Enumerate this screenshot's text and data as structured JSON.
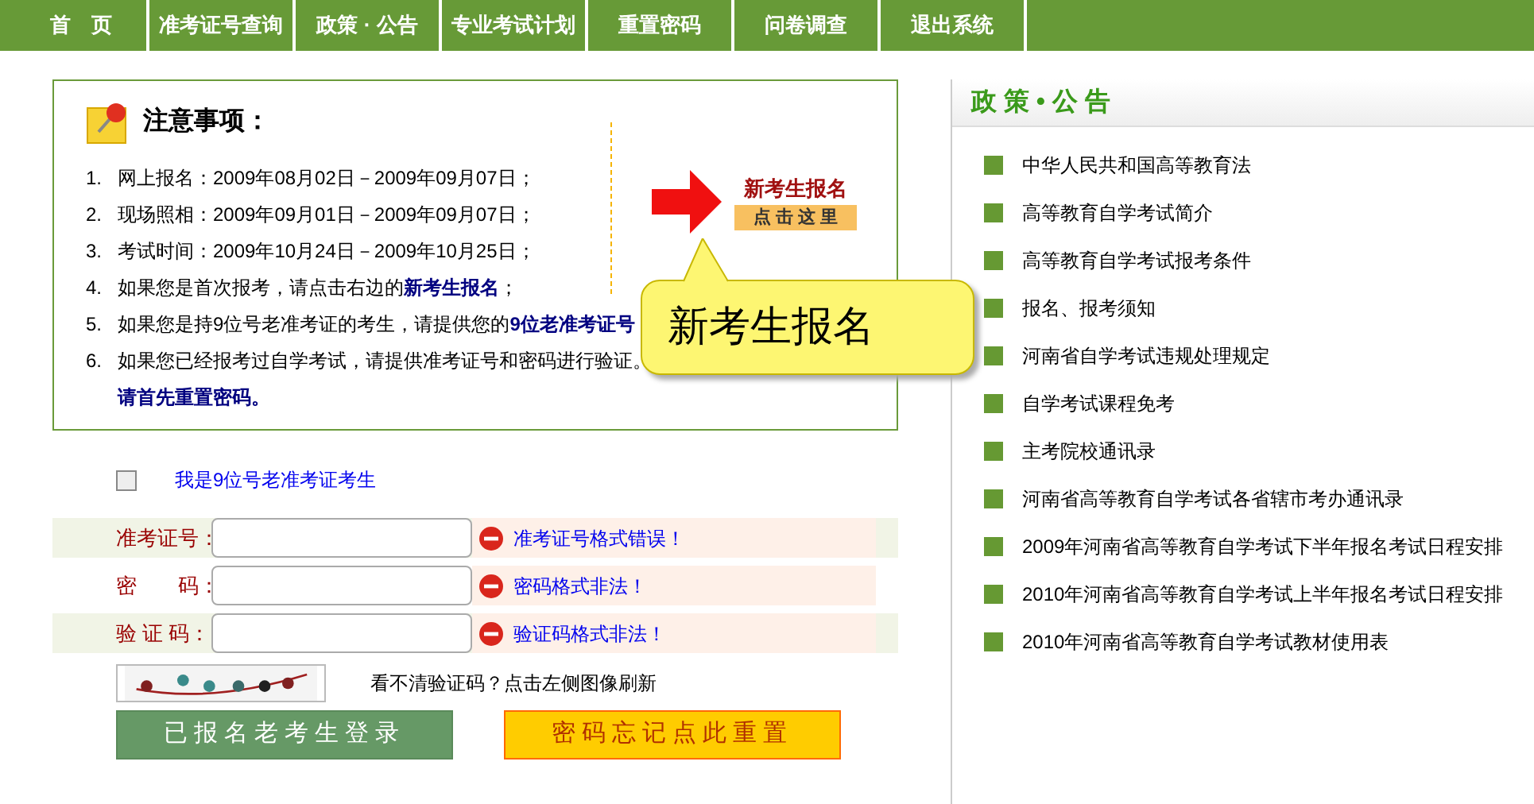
{
  "nav": [
    {
      "label": "首　页"
    },
    {
      "label": "准考证号查询"
    },
    {
      "label": "政策 · 公告"
    },
    {
      "label": "专业考试计划"
    },
    {
      "label": "重置密码"
    },
    {
      "label": "问卷调查"
    },
    {
      "label": "退出系统"
    }
  ],
  "notice": {
    "title": "注意事项：",
    "items": [
      {
        "number": "1.",
        "text": "网上报名：2009年08月02日－2009年09月07日；"
      },
      {
        "number": "2.",
        "text": "现场照相：2009年09月01日－2009年09月07日；"
      },
      {
        "number": "3.",
        "text": "考试时间：2009年10月24日－2009年10月25日；"
      },
      {
        "number": "4.",
        "text": "如果您是首次报考，请点击右边的**新考生报名**；"
      },
      {
        "number": "5.",
        "text": "如果您是持9位号老准考证的考生，请提供您的**9位老准考证号**"
      },
      {
        "number": "6.",
        "text": "如果您已经报考过自学考试，请提供准考证号和密码进行验证。",
        "continuation": "请首先重置密码。"
      }
    ],
    "promo": {
      "title": "新考生报名",
      "button": "点 击 这 里"
    },
    "callout": "新考生报名"
  },
  "old_ticket": {
    "checked": false,
    "label": "我是9位号老准考证考生"
  },
  "fields": [
    {
      "label": "准考证号：",
      "error": "准考证号格式错误！"
    },
    {
      "label": "密　　码：",
      "error": "密码格式非法！"
    },
    {
      "label": "验 证 码：",
      "error": "验证码格式非法！"
    }
  ],
  "captcha": {
    "hint": "看不清验证码？点击左侧图像刷新"
  },
  "buttons": [
    {
      "kind": "login",
      "label": "已报名老考生登录"
    },
    {
      "kind": "reset",
      "label": "密码忘记点此重置"
    }
  ],
  "sidebar": {
    "title": "政 策 • 公 告",
    "items": [
      "中华人民共和国高等教育法",
      "高等教育自学考试简介",
      "高等教育自学考试报考条件",
      "报名、报考须知",
      "河南省自学考试违规处理规定",
      "自学考试课程免考",
      "主考院校通讯录",
      "河南省高等教育自学考试各省辖市考办通讯录",
      "2009年河南省高等教育自学考试下半年报名考试日程安排",
      "2010年河南省高等教育自学考试上半年报名考试日程安排",
      "2010年河南省高等教育自学考试教材使用表"
    ]
  }
}
